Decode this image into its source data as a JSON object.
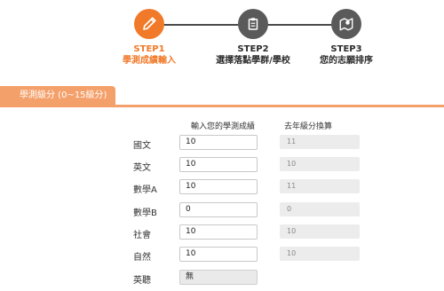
{
  "steps": [
    {
      "title": "STEP1",
      "subtitle": "學測成績輸入",
      "icon": "pencil-icon",
      "state": "active"
    },
    {
      "title": "STEP2",
      "subtitle": "選擇落點學群/學校",
      "icon": "clipboard-icon",
      "state": "inactive"
    },
    {
      "title": "STEP3",
      "subtitle": "您的志願排序",
      "icon": "map-pin-icon",
      "state": "inactive"
    }
  ],
  "section": {
    "tab_label": "學測級分 (0~15級分)"
  },
  "columns": {
    "input_header": "輸入您的學測成績",
    "compare_header": "去年級分換算"
  },
  "rows": [
    {
      "label": "國文",
      "value": "10",
      "converted": "11"
    },
    {
      "label": "英文",
      "value": "10",
      "converted": "10"
    },
    {
      "label": "數學A",
      "value": "10",
      "converted": "11"
    },
    {
      "label": "數學B",
      "value": "0",
      "converted": "0"
    },
    {
      "label": "社會",
      "value": "10",
      "converted": "10"
    },
    {
      "label": "自然",
      "value": "10",
      "converted": "10"
    },
    {
      "label": "英聽",
      "value": "無",
      "converted": ""
    }
  ],
  "colors": {
    "accent": "#f07a2a",
    "tab": "#f4a06a",
    "inactive_step": "#5a5a5a"
  }
}
